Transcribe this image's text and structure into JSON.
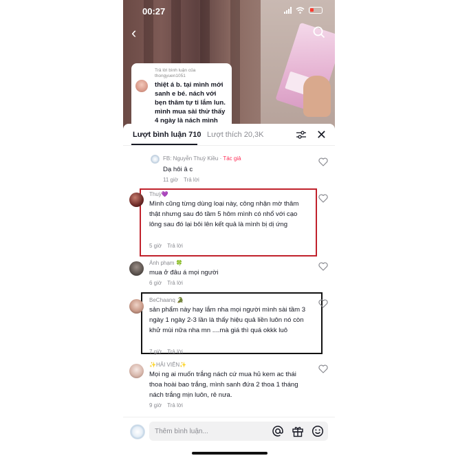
{
  "status_bar": {
    "time": "00:27"
  },
  "reply_bubble": {
    "header": "Trả lời bình luận của",
    "username": "thongyuen1051",
    "text": "thiệt á b. tại mình mới sanh e bé. nách với bẹn thâm tự ti lắm lun. mình mua sài thử thấy 4 ngày là nách mình"
  },
  "tabs": {
    "comments": "Lượt bình luận 710",
    "likes": "Lượt thích 20,3K"
  },
  "comments": [
    {
      "author": "FB: Nguyễn Thuỳ Kiều",
      "tag": "Tác giả",
      "text": "Dạ hôi â c",
      "time": "11 giờ",
      "reply": "Trả lời",
      "liked": false
    },
    {
      "author": "Thuỳ💜",
      "tag": "",
      "text": "Mình cũng từng dùng loại này, công nhận mờ thâm thật nhưng sau đó tầm 5 hôm mình có nhổ với cạo lông sau đó lại bôi lên kết quả là mình bị dị ứng",
      "time": "5 giờ",
      "reply": "Trả lời",
      "liked": false
    },
    {
      "author": "Ánh phạm 🍀",
      "tag": "",
      "text": "mua ở đâu á mọi người",
      "time": "6 giờ",
      "reply": "Trả lời",
      "liked": false
    },
    {
      "author": "BeChaanq 🐊",
      "tag": "",
      "text": "sản phẩm này hay lắm nha mọi người mình sài tầm 3 ngày 1 ngày 2-3 lần là thấy hiệu quả liền luôn nó còn khử mùi nữa nha mn ....mà giá thì quá okkk luô",
      "time": "7 giờ",
      "reply": "Trả lời",
      "liked": false
    },
    {
      "author": "✨HẢI VIÊN✨",
      "tag": "",
      "text": "Mọi ng ai muốn trắng nách cứ mua hủ kem ac thái thoa hoài bao trắng, mình sanh đứa 2 thoa 1 tháng nách trắng mịn luôn, rẻ nưa.",
      "time": "9 giờ",
      "reply": "Trả lời",
      "liked": false
    }
  ],
  "input": {
    "placeholder": "Thêm bình luận..."
  },
  "colors": {
    "author_tag": "#fe2c55",
    "highlight_red": "#c0202a",
    "highlight_black": "#111111"
  },
  "icons": [
    "back-arrow-icon",
    "search-icon",
    "filter-icon",
    "close-icon",
    "heart-icon",
    "mention-icon",
    "gift-icon",
    "emoji-icon"
  ]
}
